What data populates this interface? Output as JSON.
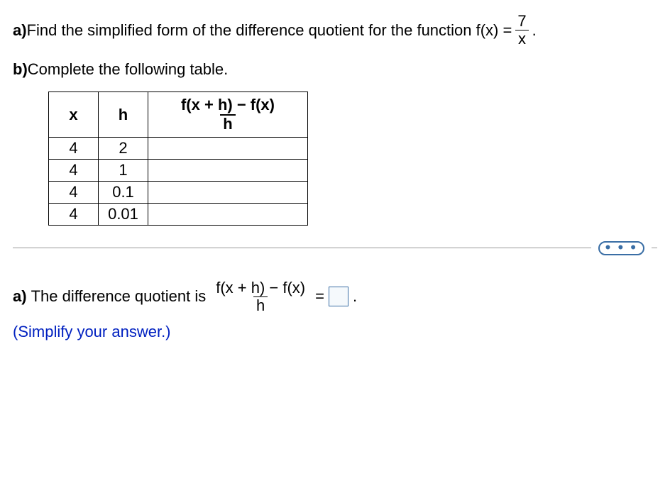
{
  "problem": {
    "partA_label": "a)",
    "partA_text": " Find the simplified form of the difference quotient for the function f(x) = ",
    "fraction_num": "7",
    "fraction_den": "x",
    "period": ".",
    "partB_label": "b)",
    "partB_text": " Complete the following table."
  },
  "table": {
    "headers": {
      "x": "x",
      "h": "h",
      "dq_num": "f(x + h) − f(x)",
      "dq_den": "h"
    },
    "rows": [
      {
        "x": "4",
        "h": "2",
        "result": ""
      },
      {
        "x": "4",
        "h": "1",
        "result": ""
      },
      {
        "x": "4",
        "h": "0.1",
        "result": ""
      },
      {
        "x": "4",
        "h": "0.01",
        "result": ""
      }
    ]
  },
  "divider": {
    "dots": "• • •"
  },
  "answer": {
    "label": "a)",
    "text_before": " The difference quotient is ",
    "dq_num": "f(x + h) − f(x)",
    "dq_den": "h",
    "equals": " = ",
    "period": ".",
    "hint": "(Simplify your answer.)"
  }
}
